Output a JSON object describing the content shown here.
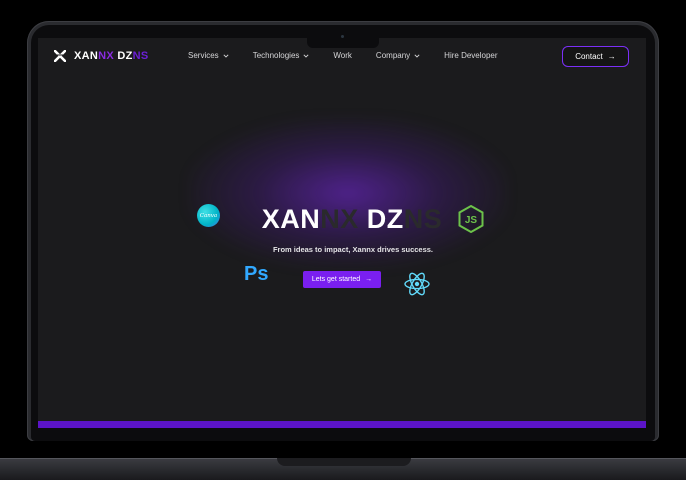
{
  "nav": {
    "brand": {
      "part1": "XAN",
      "part2": "NX",
      "part3": "DZ",
      "part4": "NS"
    },
    "menu": [
      {
        "label": "Services",
        "dropdown": true
      },
      {
        "label": "Technologies",
        "dropdown": true
      },
      {
        "label": "Work",
        "dropdown": false
      },
      {
        "label": "Company",
        "dropdown": true
      },
      {
        "label": "Hire Developer",
        "dropdown": false
      }
    ],
    "contact_label": "Contact"
  },
  "hero": {
    "title_part1": "XAN",
    "title_part2": "NX",
    "title_part3": "DZ",
    "title_part4": "NS",
    "subtitle": "From ideas to impact, Xannx drives success.",
    "cta_label": "Lets get started"
  },
  "tech_icons": {
    "canva": "Canva",
    "photoshop": "Ps",
    "nodejs": "JS",
    "react": "react-icon"
  },
  "colors": {
    "accent": "#7a1ff0",
    "accent_light": "#8a2be2",
    "background": "#1b1b1d",
    "photoshop": "#31a8ff",
    "react": "#61dafb",
    "node": "#6cc24a"
  }
}
